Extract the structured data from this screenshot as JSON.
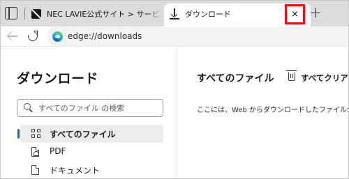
{
  "tabs": [
    {
      "title": "NEC LAVIE公式サイト > サービス＆サ",
      "favicon": "nec-icon",
      "active": false
    },
    {
      "title": "ダウンロード",
      "favicon": "download-icon",
      "active": true
    }
  ],
  "tab_close_symbol": "×",
  "new_tab_symbol": "+",
  "address": {
    "url": "edge://downloads"
  },
  "sidebar": {
    "title": "ダウンロード",
    "search": {
      "placeholder": "すべてのファイル の検索",
      "value": ""
    },
    "items": [
      {
        "label": "すべてのファイル",
        "icon": "grid-icon",
        "active": true
      },
      {
        "label": "PDF",
        "icon": "pdf-icon",
        "active": false
      },
      {
        "label": "ドキュメント",
        "icon": "document-icon",
        "active": false
      }
    ]
  },
  "main": {
    "title": "すべてのファイル",
    "clear_all_label": "すべてクリア",
    "info_text": "ここには、Web からダウンロードしたファイルが表示"
  },
  "colors": {
    "accent": "#0f6cbd",
    "highlight_box": "#e8141c",
    "tabstrip_bg": "#dcdcdc"
  }
}
